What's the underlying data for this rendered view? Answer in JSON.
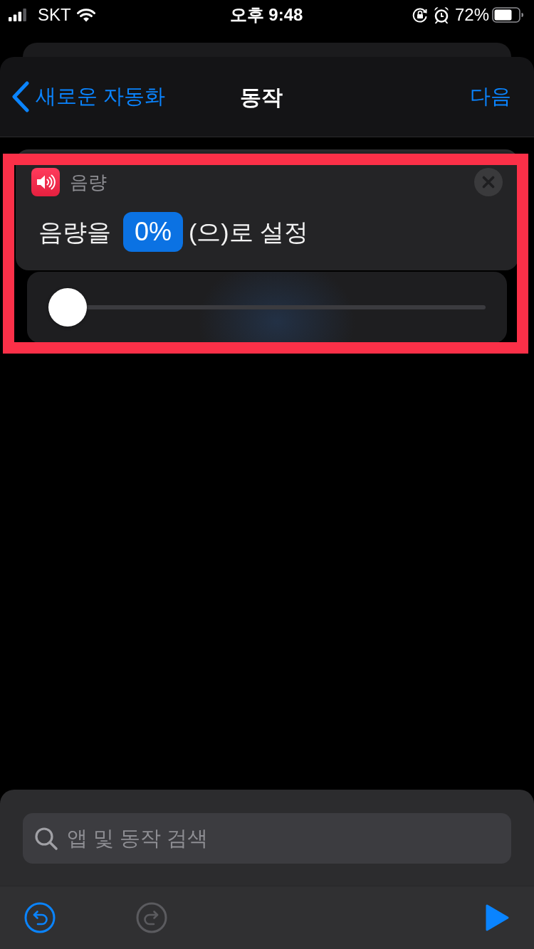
{
  "status_bar": {
    "carrier": "SKT",
    "time": "오후 9:48",
    "battery": "72%"
  },
  "nav_bar": {
    "back": "새로운 자동화",
    "title": "동작",
    "next": "다음"
  },
  "action": {
    "highlighted": true,
    "app": "음량",
    "sentence_before": "음량을",
    "token": "0%",
    "sentence_after": "(으)로 설정",
    "slider": {
      "level": 0
    }
  },
  "search": {
    "placeholder": "앱 및 동작 검색"
  },
  "toolbar": [
    {
      "kind": "undo",
      "disabled": false
    },
    {
      "kind": "redo",
      "disabled": true
    },
    {
      "kind": "run",
      "disabled": false
    }
  ]
}
